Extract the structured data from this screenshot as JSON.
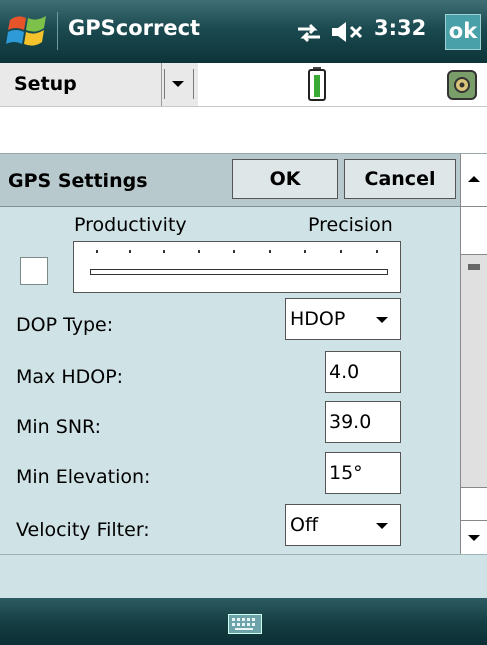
{
  "titlebar": {
    "app_title": "GPScorrect",
    "time": "3:32",
    "ok_label": "ok",
    "icons": [
      "windows-start-icon",
      "sync-icon",
      "volume-muted-icon"
    ]
  },
  "menubar": {
    "setup_label": "Setup",
    "icons": [
      "battery-icon",
      "gps-settings-icon"
    ]
  },
  "panel": {
    "title": "GPS Settings",
    "ok_label": "OK",
    "cancel_label": "Cancel",
    "slider": {
      "left_label": "Productivity",
      "right_label": "Precision"
    },
    "fields": {
      "dop_type_label": "DOP Type:",
      "dop_type_value": "HDOP",
      "max_hdop_label": "Max HDOP:",
      "max_hdop_value": "4.0",
      "min_snr_label": "Min SNR:",
      "min_snr_value": "39.0",
      "min_elev_label": "Min Elevation:",
      "min_elev_value": "15°",
      "velocity_label": "Velocity Filter:",
      "velocity_value": "Off"
    }
  },
  "colors": {
    "title_bar": "#1b4a50",
    "panel_bg": "#cfe2e6",
    "header_bg": "#b7c9cd"
  }
}
